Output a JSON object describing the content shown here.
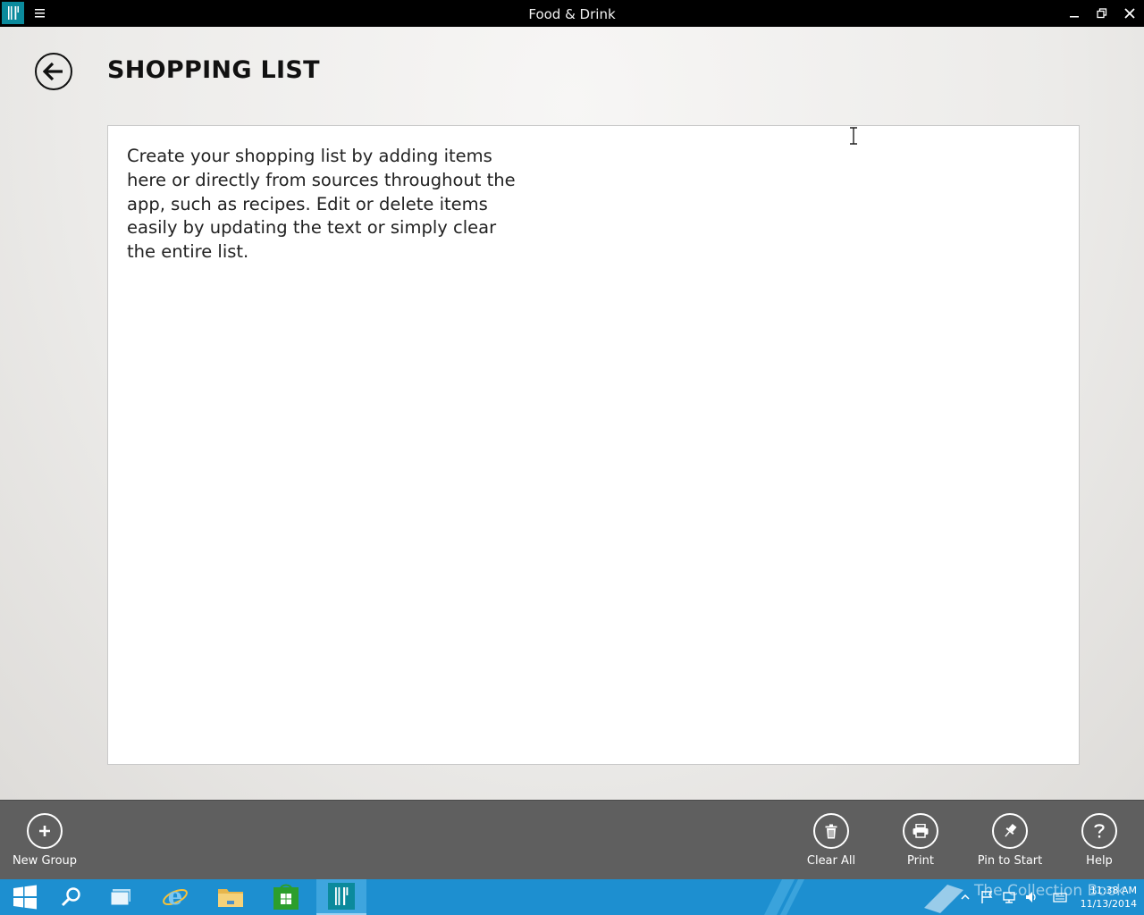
{
  "window": {
    "title": "Food & Drink",
    "app_icon": "fork-knife-icon",
    "menu_icon": "hamburger-icon",
    "controls": [
      "minimize-icon",
      "restore-icon",
      "close-icon"
    ]
  },
  "page": {
    "title": "SHOPPING LIST",
    "back_icon": "back-arrow-icon",
    "list_hint": "Create your shopping list by adding items here or directly from sources throughout the app, such as recipes. Edit or delete items easily by updating the text or simply clear the entire list."
  },
  "app_bar": {
    "new_group": {
      "label": "New Group",
      "icon": "plus-icon"
    },
    "clear_all": {
      "label": "Clear All",
      "icon": "trash-icon"
    },
    "print": {
      "label": "Print",
      "icon": "printer-icon"
    },
    "pin_to_start": {
      "label": "Pin to Start",
      "icon": "pin-icon"
    },
    "help": {
      "label": "Help",
      "icon": "question-icon"
    }
  },
  "taskbar": {
    "items": [
      "start-icon",
      "search-icon",
      "task-view-icon",
      "internet-explorer-icon",
      "file-explorer-icon",
      "store-icon",
      "food-drink-icon"
    ],
    "active": "food-drink-icon",
    "watermark": "The Collection Book",
    "time": "11:38 AM",
    "date": "11/13/2014"
  },
  "colors": {
    "titlebar": "#000000",
    "app_bar": "#5f5f5f",
    "taskbar": "#1d8fd0",
    "app_accent": "#0b8a9c"
  }
}
